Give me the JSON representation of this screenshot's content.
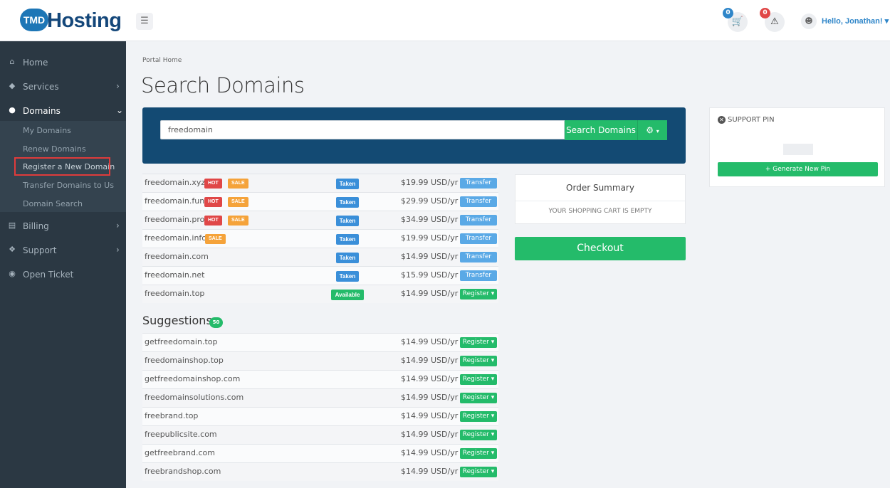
{
  "brand": {
    "badge": "TMD",
    "word": "Hosting"
  },
  "header": {
    "cart_count": "0",
    "alerts_count": "0",
    "user_greeting": "Hello, Jonathan! ▾"
  },
  "sidebar": {
    "items": [
      {
        "label": "Home",
        "icon": "home-icon"
      },
      {
        "label": "Services",
        "icon": "cube-icon"
      },
      {
        "label": "Domains",
        "icon": "globe-icon"
      },
      {
        "label": "Billing",
        "icon": "file-icon"
      },
      {
        "label": "Support",
        "icon": "lifebuoy-icon"
      },
      {
        "label": "Open Ticket",
        "icon": "comment-icon"
      }
    ],
    "domain_sub": [
      "My Domains",
      "Renew Domains",
      "Register a New Domain",
      "Transfer Domains to Us",
      "Domain Search"
    ]
  },
  "breadcrumb": "Portal Home",
  "title": "Search Domains",
  "search": {
    "value": "freedomain",
    "button": "Search Domains"
  },
  "results": [
    {
      "name": "freedomain.xyz",
      "tags": [
        "HOT",
        "SALE"
      ],
      "status": "Taken",
      "price": "$19.99 USD/yr",
      "action": "Transfer"
    },
    {
      "name": "freedomain.fun",
      "tags": [
        "HOT",
        "SALE"
      ],
      "status": "Taken",
      "price": "$29.99 USD/yr",
      "action": "Transfer"
    },
    {
      "name": "freedomain.pro",
      "tags": [
        "HOT",
        "SALE"
      ],
      "status": "Taken",
      "price": "$34.99 USD/yr",
      "action": "Transfer"
    },
    {
      "name": "freedomain.info",
      "tags": [
        "SALE"
      ],
      "status": "Taken",
      "price": "$19.99 USD/yr",
      "action": "Transfer"
    },
    {
      "name": "freedomain.com",
      "tags": [],
      "status": "Taken",
      "price": "$14.99 USD/yr",
      "action": "Transfer"
    },
    {
      "name": "freedomain.net",
      "tags": [],
      "status": "Taken",
      "price": "$15.99 USD/yr",
      "action": "Transfer"
    },
    {
      "name": "freedomain.top",
      "tags": [],
      "status": "Available",
      "price": "$14.99 USD/yr",
      "action": "Register ▾"
    }
  ],
  "suggestions": {
    "title": "Suggestions",
    "count": "50",
    "items": [
      {
        "name": "getfreedomain.top",
        "price": "$14.99 USD/yr",
        "action": "Register ▾"
      },
      {
        "name": "freedomainshop.top",
        "price": "$14.99 USD/yr",
        "action": "Register ▾"
      },
      {
        "name": "getfreedomainshop.com",
        "price": "$14.99 USD/yr",
        "action": "Register ▾"
      },
      {
        "name": "freedomainsolutions.com",
        "price": "$14.99 USD/yr",
        "action": "Register ▾"
      },
      {
        "name": "freebrand.top",
        "price": "$14.99 USD/yr",
        "action": "Register ▾"
      },
      {
        "name": "freepublicsite.com",
        "price": "$14.99 USD/yr",
        "action": "Register ▾"
      },
      {
        "name": "getfreebrand.com",
        "price": "$14.99 USD/yr",
        "action": "Register ▾"
      },
      {
        "name": "freebrandshop.com",
        "price": "$14.99 USD/yr",
        "action": "Register ▾"
      }
    ]
  },
  "order": {
    "title": "Order Summary",
    "empty": "YOUR SHOPPING CART IS EMPTY",
    "checkout": "Checkout"
  },
  "support_pin": {
    "title": "SUPPORT PIN",
    "button": "+ Generate New Pin"
  },
  "colors": {
    "accent": "#24bb6a",
    "sidebar": "#2b3843",
    "panel": "#134a73",
    "hot": "#e04747",
    "sale": "#f5a33a",
    "taken": "#3a8fd9",
    "highlight": "#e03b3b"
  }
}
